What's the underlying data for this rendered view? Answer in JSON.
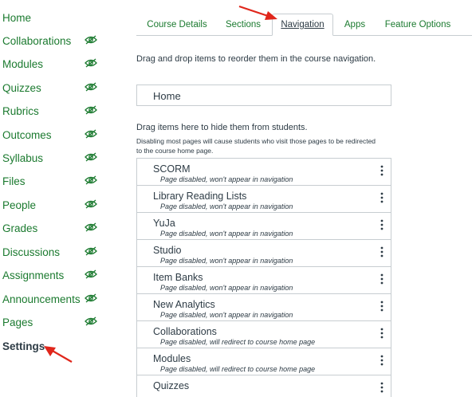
{
  "course_nav": [
    {
      "label": "Home",
      "hidden": false,
      "active": false
    },
    {
      "label": "Collaborations",
      "hidden": true,
      "active": false
    },
    {
      "label": "Modules",
      "hidden": true,
      "active": false
    },
    {
      "label": "Quizzes",
      "hidden": true,
      "active": false
    },
    {
      "label": "Rubrics",
      "hidden": true,
      "active": false
    },
    {
      "label": "Outcomes",
      "hidden": true,
      "active": false
    },
    {
      "label": "Syllabus",
      "hidden": true,
      "active": false
    },
    {
      "label": "Files",
      "hidden": true,
      "active": false
    },
    {
      "label": "People",
      "hidden": true,
      "active": false
    },
    {
      "label": "Grades",
      "hidden": true,
      "active": false
    },
    {
      "label": "Discussions",
      "hidden": true,
      "active": false
    },
    {
      "label": "Assignments",
      "hidden": true,
      "active": false
    },
    {
      "label": "Announcements",
      "hidden": true,
      "active": false
    },
    {
      "label": "Pages",
      "hidden": true,
      "active": false
    },
    {
      "label": "Settings",
      "hidden": false,
      "active": true
    }
  ],
  "tabs": [
    {
      "label": "Course Details",
      "active": false
    },
    {
      "label": "Sections",
      "active": false
    },
    {
      "label": "Navigation",
      "active": true
    },
    {
      "label": "Apps",
      "active": false
    },
    {
      "label": "Feature Options",
      "active": false
    }
  ],
  "navigation": {
    "reorder_instruction": "Drag and drop items to reorder them in the course navigation.",
    "enabled_items": [
      "Home"
    ],
    "hide_instruction": "Drag items here to hide them from students.",
    "hide_note_line1": "Disabling most pages will cause students who visit those pages to be redirected",
    "hide_note_line2": "to the course home page.",
    "disabled_items": [
      {
        "name": "SCORM",
        "status": "Page disabled, won't appear in navigation"
      },
      {
        "name": "Library Reading Lists",
        "status": "Page disabled, won't appear in navigation"
      },
      {
        "name": "YuJa",
        "status": "Page disabled, won't appear in navigation"
      },
      {
        "name": "Studio",
        "status": "Page disabled, won't appear in navigation"
      },
      {
        "name": "Item Banks",
        "status": "Page disabled, won't appear in navigation"
      },
      {
        "name": "New Analytics",
        "status": "Page disabled, won't appear in navigation"
      },
      {
        "name": "Collaborations",
        "status": "Page disabled, will redirect to course home page"
      },
      {
        "name": "Modules",
        "status": "Page disabled, will redirect to course home page"
      },
      {
        "name": "Quizzes",
        "status": ""
      }
    ]
  },
  "icons": {
    "hidden_eye": "eye-slash-icon",
    "item_menu": "kebab-menu-icon"
  },
  "colors": {
    "link_green": "#1b7a2f",
    "text": "#2d3b45",
    "border": "#c7cdd1",
    "arrow_red": "#e0261b"
  }
}
